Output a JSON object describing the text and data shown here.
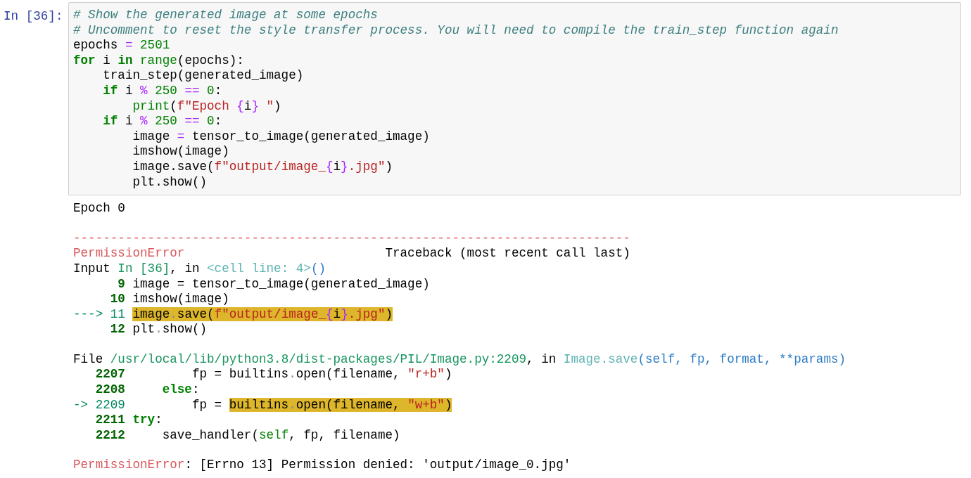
{
  "cell": {
    "prompt": "In [36]:",
    "lines": [
      [
        {
          "kind": "comment",
          "text": "# Show the generated image at some epochs"
        }
      ],
      [
        {
          "kind": "comment",
          "text": "# Uncomment to reset the style transfer process. You will need to compile the train_step function again"
        }
      ],
      [
        {
          "kind": "plain",
          "text": "epochs "
        },
        {
          "kind": "op",
          "text": "="
        },
        {
          "kind": "num",
          "text": " 2501"
        }
      ],
      [
        {
          "kind": "kw",
          "text": "for"
        },
        {
          "kind": "plain",
          "text": " i "
        },
        {
          "kind": "kw",
          "text": "in"
        },
        {
          "kind": "builtin",
          "text": " range"
        },
        {
          "kind": "plain",
          "text": "(epochs):"
        }
      ],
      [
        {
          "kind": "plain",
          "text": "    train_step(generated_image)"
        }
      ],
      [
        {
          "kind": "kw",
          "text": "    if"
        },
        {
          "kind": "plain",
          "text": " i "
        },
        {
          "kind": "op",
          "text": "%"
        },
        {
          "kind": "num",
          "text": " 250 "
        },
        {
          "kind": "op",
          "text": "=="
        },
        {
          "kind": "num",
          "text": " 0"
        },
        {
          "kind": "plain",
          "text": ":"
        }
      ],
      [
        {
          "kind": "builtin",
          "text": "        print"
        },
        {
          "kind": "plain",
          "text": "("
        },
        {
          "kind": "str",
          "text": "f\"Epoch "
        },
        {
          "kind": "op",
          "text": "{"
        },
        {
          "kind": "plain",
          "text": "i"
        },
        {
          "kind": "op",
          "text": "}"
        },
        {
          "kind": "str",
          "text": " \""
        },
        {
          "kind": "plain",
          "text": ")"
        }
      ],
      [
        {
          "kind": "kw",
          "text": "    if"
        },
        {
          "kind": "plain",
          "text": " i "
        },
        {
          "kind": "op",
          "text": "%"
        },
        {
          "kind": "num",
          "text": " 250 "
        },
        {
          "kind": "op",
          "text": "=="
        },
        {
          "kind": "num",
          "text": " 0"
        },
        {
          "kind": "plain",
          "text": ":"
        }
      ],
      [
        {
          "kind": "plain",
          "text": "        image "
        },
        {
          "kind": "op",
          "text": "="
        },
        {
          "kind": "plain",
          "text": " tensor_to_image(generated_image)"
        }
      ],
      [
        {
          "kind": "plain",
          "text": "        imshow(image)"
        }
      ],
      [
        {
          "kind": "plain",
          "text": "        image.save("
        },
        {
          "kind": "str",
          "text": "f\"output/image_"
        },
        {
          "kind": "op",
          "text": "{"
        },
        {
          "kind": "plain",
          "text": "i"
        },
        {
          "kind": "op",
          "text": "}"
        },
        {
          "kind": "str",
          "text": ".jpg\""
        },
        {
          "kind": "plain",
          "text": ")"
        }
      ],
      [
        {
          "kind": "plain",
          "text": "        plt.show()"
        }
      ]
    ]
  },
  "output": {
    "blocks": [
      [
        [
          {
            "kind": "plain",
            "text": "Epoch 0"
          }
        ]
      ],
      [
        [
          {
            "kind": "err",
            "text": "---------------------------------------------------------------------------"
          }
        ],
        [
          {
            "kind": "err",
            "text": "PermissionError"
          },
          {
            "kind": "plain",
            "text": "                           Traceback (most recent call last)"
          }
        ],
        [
          {
            "kind": "plain",
            "text": "Input "
          },
          {
            "kind": "path",
            "text": "In [36]"
          },
          {
            "kind": "plain",
            "text": ", in "
          },
          {
            "kind": "cyan",
            "text": "<cell line: 4>"
          },
          {
            "kind": "blue",
            "text": "()"
          }
        ],
        [
          {
            "kind": "lineno",
            "text": "      9"
          },
          {
            "kind": "plain",
            "text": " image = tensor_to_image(generated_image)"
          }
        ],
        [
          {
            "kind": "lineno",
            "text": "     10"
          },
          {
            "kind": "plain",
            "text": " imshow(image)"
          }
        ],
        [
          {
            "kind": "arrow",
            "text": "---> 11 "
          },
          {
            "kind": "highlight",
            "parts": [
              {
                "kind": "plain",
                "text": "image"
              },
              {
                "kind": "dim",
                "text": "."
              },
              {
                "kind": "plain",
                "text": "save("
              },
              {
                "kind": "str",
                "text": "f\"output/image_"
              },
              {
                "kind": "op",
                "text": "{"
              },
              {
                "kind": "plain",
                "text": "i"
              },
              {
                "kind": "op",
                "text": "}"
              },
              {
                "kind": "str",
                "text": ".jpg\""
              },
              {
                "kind": "plain",
                "text": ")"
              }
            ]
          }
        ],
        [
          {
            "kind": "lineno",
            "text": "     12"
          },
          {
            "kind": "plain",
            "text": " plt"
          },
          {
            "kind": "dim",
            "text": "."
          },
          {
            "kind": "plain",
            "text": "show()"
          }
        ]
      ],
      [
        [
          {
            "kind": "plain",
            "text": "File "
          },
          {
            "kind": "path",
            "text": "/usr/local/lib/python3.8/dist-packages/PIL/Image.py:2209"
          },
          {
            "kind": "plain",
            "text": ", in "
          },
          {
            "kind": "cyan",
            "text": "Image.save"
          },
          {
            "kind": "blue",
            "text": "(self, fp, format, **params)"
          }
        ],
        [
          {
            "kind": "lineno",
            "text": "   2207"
          },
          {
            "kind": "plain",
            "text": "         fp = builtins"
          },
          {
            "kind": "dim",
            "text": "."
          },
          {
            "kind": "plain",
            "text": "open(filename, "
          },
          {
            "kind": "str",
            "text": "\"r+b\""
          },
          {
            "kind": "plain",
            "text": ")"
          }
        ],
        [
          {
            "kind": "lineno",
            "text": "   2208"
          },
          {
            "kind": "kw",
            "text": "     else"
          },
          {
            "kind": "plain",
            "text": ":"
          }
        ],
        [
          {
            "kind": "arrow",
            "text": "-> 2209"
          },
          {
            "kind": "plain",
            "text": "         fp = "
          },
          {
            "kind": "highlight",
            "parts": [
              {
                "kind": "plain",
                "text": "builtins"
              },
              {
                "kind": "dim",
                "text": "."
              },
              {
                "kind": "plain",
                "text": "open(filename, "
              },
              {
                "kind": "str",
                "text": "\"w+b\""
              },
              {
                "kind": "plain",
                "text": ")"
              }
            ]
          }
        ],
        [
          {
            "kind": "lineno",
            "text": "   2211"
          },
          {
            "kind": "kw",
            "text": " try"
          },
          {
            "kind": "plain",
            "text": ":"
          }
        ],
        [
          {
            "kind": "lineno",
            "text": "   2212"
          },
          {
            "kind": "plain",
            "text": "     save_handler("
          },
          {
            "kind": "builtin",
            "text": "self"
          },
          {
            "kind": "plain",
            "text": ", fp, filename)"
          }
        ]
      ],
      [
        [
          {
            "kind": "err",
            "text": "PermissionError"
          },
          {
            "kind": "plain",
            "text": ": [Errno 13] Permission denied: 'output/image_0.jpg'"
          }
        ]
      ]
    ]
  }
}
